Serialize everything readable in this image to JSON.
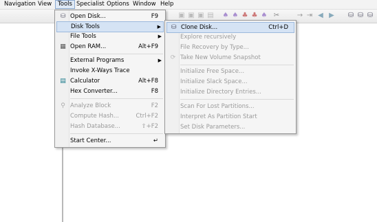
{
  "menubar": {
    "items": [
      "Navigation",
      "View",
      "Tools",
      "Specialist",
      "Options",
      "Window",
      "Help"
    ]
  },
  "tools_menu": {
    "items": [
      {
        "label": "Open Disk...",
        "shortcut": "F9"
      },
      {
        "label": "Disk Tools",
        "shortcut": ""
      },
      {
        "label": "File Tools",
        "shortcut": ""
      },
      {
        "label": "Open RAM...",
        "shortcut": "Alt+F9"
      },
      {
        "label": "External Programs",
        "shortcut": ""
      },
      {
        "label": "Invoke X-Ways Trace",
        "shortcut": ""
      },
      {
        "label": "Calculator",
        "shortcut": "Alt+F8"
      },
      {
        "label": "Hex Converter...",
        "shortcut": "F8"
      },
      {
        "label": "Analyze Block",
        "shortcut": "F2"
      },
      {
        "label": "Compute Hash...",
        "shortcut": "Ctrl+F2"
      },
      {
        "label": "Hash Database...",
        "shortcut": "⇧+F2"
      },
      {
        "label": "Start Center...",
        "shortcut": "↵"
      }
    ]
  },
  "disk_tools_menu": {
    "items": [
      {
        "label": "Clone Disk...",
        "shortcut": "Ctrl+D"
      },
      {
        "label": "Explore recursively",
        "shortcut": ""
      },
      {
        "label": "File Recovery by Type...",
        "shortcut": ""
      },
      {
        "label": "Take New Volume Snapshot",
        "shortcut": ""
      },
      {
        "label": "Initialize Free Space...",
        "shortcut": ""
      },
      {
        "label": "Initialize Slack Space...",
        "shortcut": ""
      },
      {
        "label": "Initialize Directory Entries...",
        "shortcut": ""
      },
      {
        "label": "Scan For Lost Partitions...",
        "shortcut": ""
      },
      {
        "label": "Interpret As Partition Start",
        "shortcut": ""
      },
      {
        "label": "Set Disk Parameters...",
        "shortcut": ""
      }
    ]
  },
  "colors": {
    "highlight": "#d5e3f4",
    "menu_bg": "#f5f5f5",
    "disabled_text": "#9a9a9a"
  }
}
